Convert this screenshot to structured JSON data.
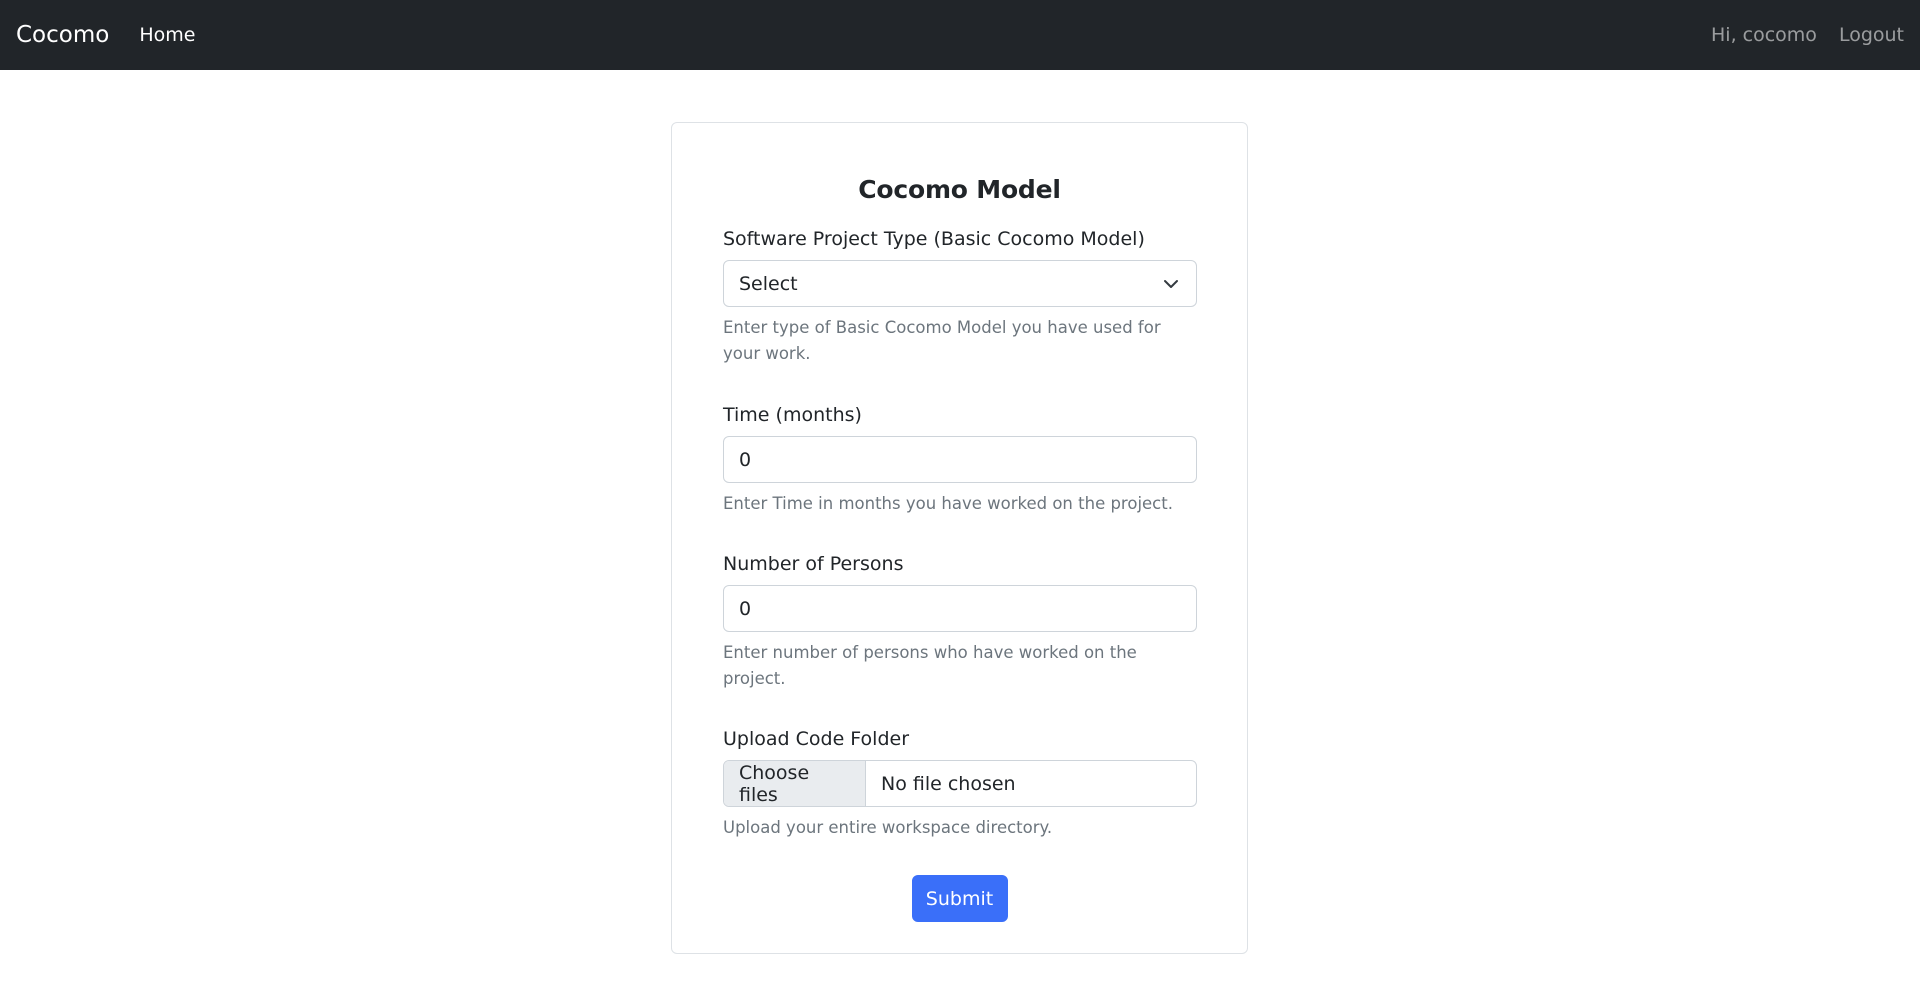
{
  "navbar": {
    "brand": "Cocomo",
    "links": [
      {
        "label": "Home"
      }
    ],
    "greeting": "Hi, cocomo",
    "logout_label": "Logout"
  },
  "form": {
    "title": "Cocomo Model",
    "project_type": {
      "label": "Software Project Type (Basic Cocomo Model)",
      "selected": "Select",
      "help": "Enter type of Basic Cocomo Model you have used for your work."
    },
    "time": {
      "label": "Time (months)",
      "value": "0",
      "help": "Enter Time in months you have worked on the project."
    },
    "persons": {
      "label": "Number of Persons",
      "value": "0",
      "help": "Enter number of persons who have worked on the project."
    },
    "upload": {
      "label": "Upload Code Folder",
      "button_label": "Choose files",
      "status": "No file chosen",
      "help": "Upload your entire workspace directory."
    },
    "submit_label": "Submit"
  },
  "colors": {
    "navbar_bg": "#212529",
    "primary": "#3a6ff9",
    "muted_text": "#6c757d"
  }
}
